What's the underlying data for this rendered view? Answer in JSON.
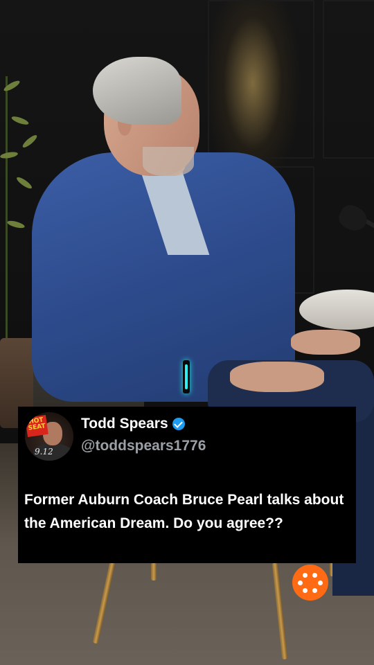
{
  "tweet": {
    "display_name": "Todd Spears",
    "handle": "@toddspears1776",
    "text": "Former Auburn Coach Bruce Pearl talks about the American Dream. Do you agree??",
    "avatar": {
      "badge_text": "HOT SEAT",
      "number": "9.12"
    }
  },
  "icons": {
    "verified": "verified-badge-icon",
    "fab": "grid-dots-icon",
    "cursor": "text-cursor-icon"
  },
  "colors": {
    "verified": "#1d9bf0",
    "fab": "#ff6a14",
    "cursor": "#2ef0f0",
    "card_background": "#000000"
  }
}
